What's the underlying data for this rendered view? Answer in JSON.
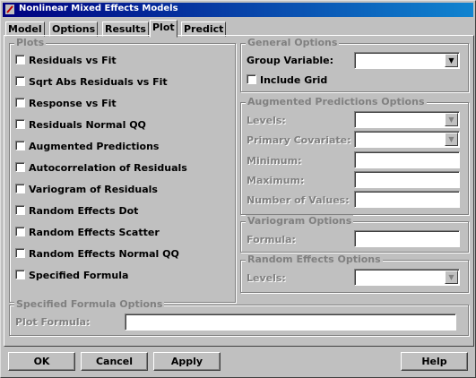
{
  "window": {
    "title": "Nonlinear Mixed Effects Models"
  },
  "tabs": [
    {
      "label": "Model",
      "active": false
    },
    {
      "label": "Options",
      "active": false
    },
    {
      "label": "Results",
      "active": false
    },
    {
      "label": "Plot",
      "active": true
    },
    {
      "label": "Predict",
      "active": false
    }
  ],
  "plots": {
    "legend": "Plots",
    "items": [
      {
        "label": "Residuals vs Fit",
        "checked": false
      },
      {
        "label": "Sqrt Abs Residuals vs Fit",
        "checked": false
      },
      {
        "label": "Response vs Fit",
        "checked": false
      },
      {
        "label": "Residuals Normal QQ",
        "checked": false
      },
      {
        "label": "Augmented Predictions",
        "checked": false
      },
      {
        "label": "Autocorrelation of Residuals",
        "checked": false
      },
      {
        "label": "Variogram of Residuals",
        "checked": false
      },
      {
        "label": "Random Effects Dot",
        "checked": false
      },
      {
        "label": "Random Effects Scatter",
        "checked": false
      },
      {
        "label": "Random Effects Normal QQ",
        "checked": false
      },
      {
        "label": "Specified Formula",
        "checked": false
      }
    ]
  },
  "general": {
    "legend": "General Options",
    "group_variable_label": "Group Variable:",
    "group_variable_value": "",
    "include_grid_label": "Include Grid",
    "include_grid_checked": false
  },
  "augmented": {
    "legend": "Augmented Predictions Options",
    "levels_label": "Levels:",
    "primary_covariate_label": "Primary Covariate:",
    "minimum_label": "Minimum:",
    "maximum_label": "Maximum:",
    "number_of_values_label": "Number of Values:"
  },
  "variogram": {
    "legend": "Variogram Options",
    "formula_label": "Formula:"
  },
  "random_effects": {
    "legend": "Random Effects Options",
    "levels_label": "Levels:"
  },
  "specified_formula": {
    "legend": "Specified Formula Options",
    "plot_formula_label": "Plot Formula:",
    "plot_formula_value": ""
  },
  "buttons": {
    "ok": "OK",
    "cancel": "Cancel",
    "apply": "Apply",
    "help": "Help"
  },
  "colors": {
    "title_bar": "#000080",
    "face": "#c0c0c0",
    "disabled_text": "#808080"
  }
}
